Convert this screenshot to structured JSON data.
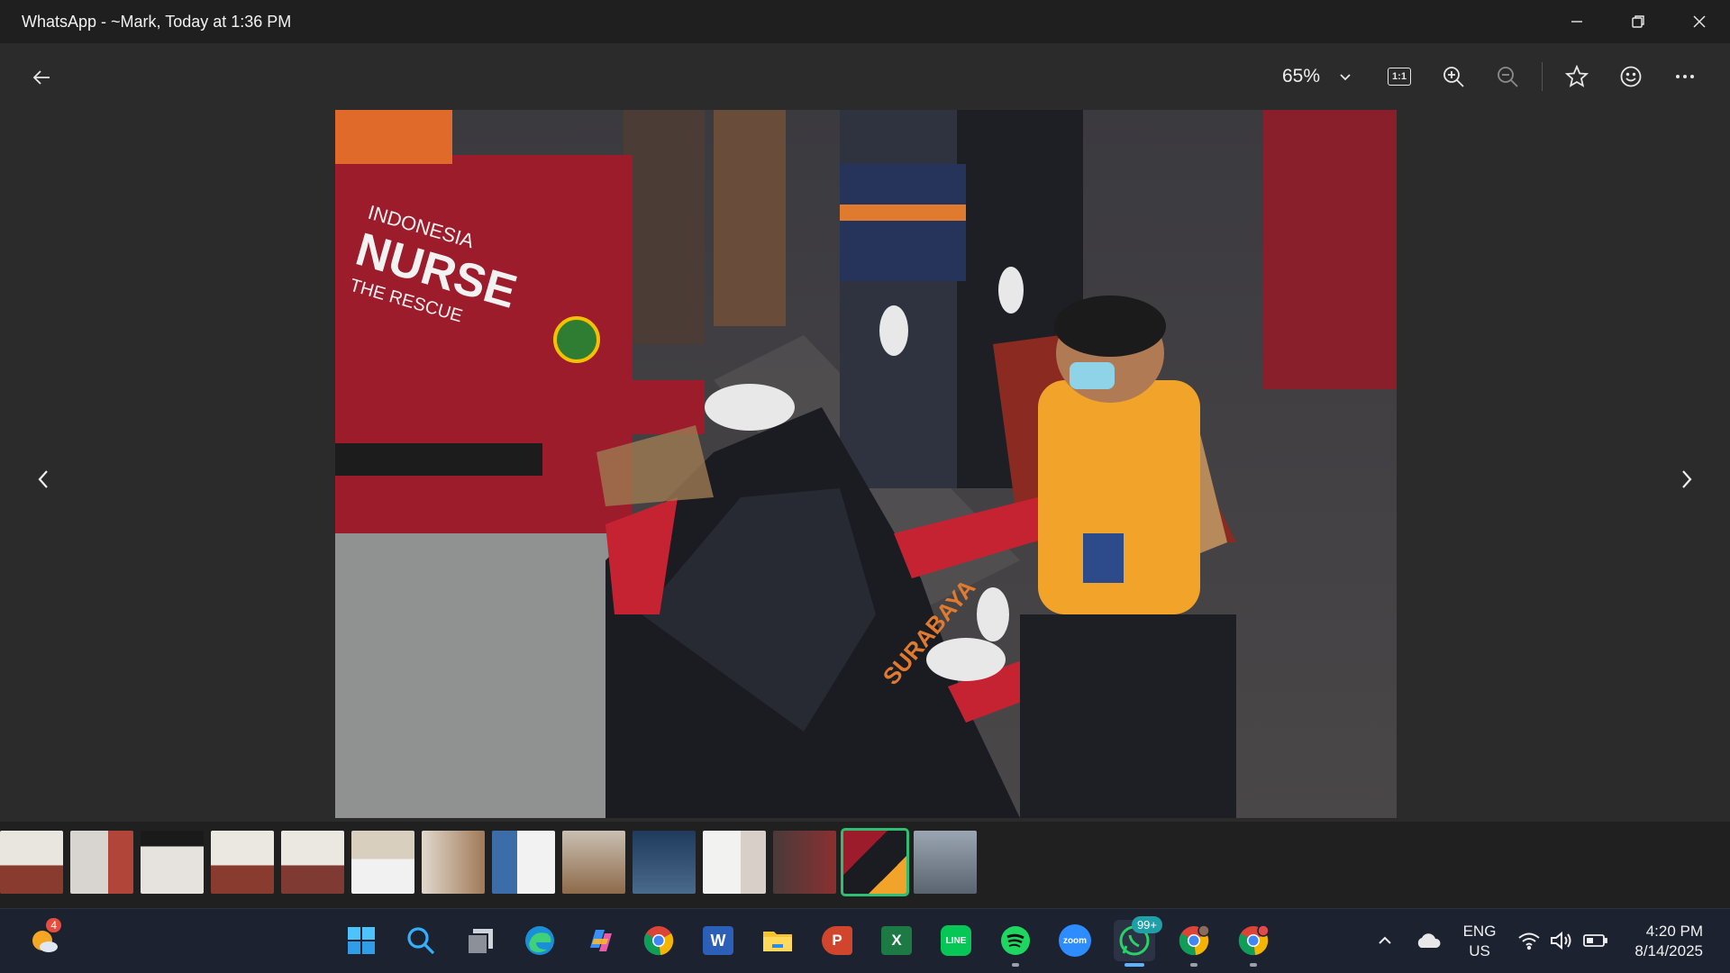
{
  "window": {
    "title": "WhatsApp - ~Mark, Today at 1:36 PM",
    "minimize_icon": "minimize-icon",
    "restore_icon": "restore-icon",
    "close_icon": "close-icon"
  },
  "toolbar": {
    "zoom_level": "65%",
    "icons": [
      "back-arrow-icon",
      "chevron-down-icon",
      "actual-size-icon",
      "zoom-in-icon",
      "zoom-out-icon",
      "star-icon",
      "emoji-icon",
      "more-icon"
    ],
    "actual_size_label": "1:1"
  },
  "viewer": {
    "photo_text": {
      "shirt_line1": "INDONESIA",
      "shirt_line2": "NURSE",
      "shirt_line3": "THE RESCUE",
      "bag_text": "SURABAYA"
    }
  },
  "thumbnails": {
    "count": 14,
    "selected_index": 12
  },
  "taskbar": {
    "weather_badge": "4",
    "whatsapp_badge": "99+",
    "apps": [
      "windows-start-icon",
      "search-icon",
      "task-view-icon",
      "edge-icon",
      "copilot-icon",
      "chrome-icon",
      "word-icon",
      "file-explorer-icon",
      "powerpoint-icon",
      "excel-icon",
      "line-icon",
      "spotify-icon",
      "zoom-icon",
      "whatsapp-icon",
      "chrome-profile-icon",
      "chrome-profile-2-icon"
    ],
    "word_letter": "W",
    "powerpoint_letter": "P",
    "excel_letter": "X",
    "line_label": "LINE",
    "zoom_label": "zoom",
    "tray": {
      "lang_line1": "ENG",
      "lang_line2": "US",
      "time": "4:20 PM",
      "date": "8/14/2025"
    }
  },
  "colors": {
    "accent_selected": "#2fbf72",
    "whatsapp_green": "#25d366",
    "nurse_shirt": "#9c1c2c",
    "rescue_shirt": "#f2a42a"
  }
}
